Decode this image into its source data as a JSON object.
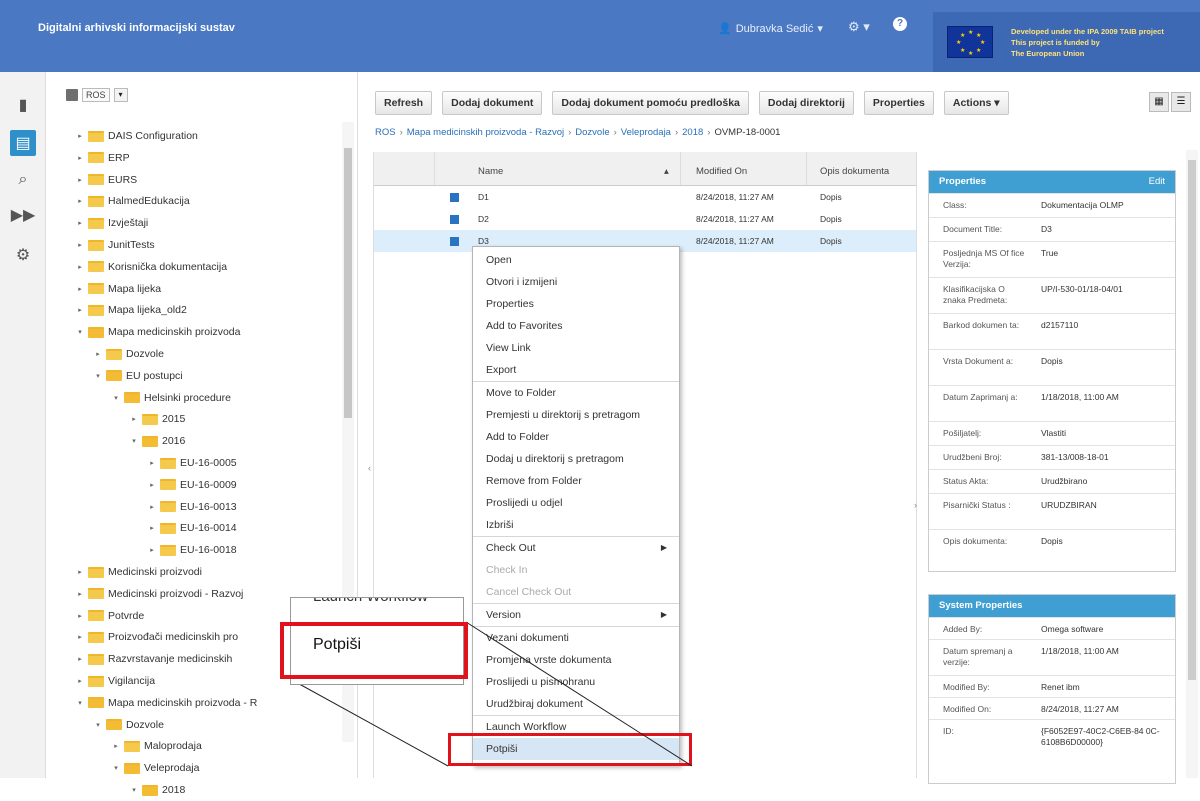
{
  "header": {
    "app_title": "Digitalni arhivski informacijski sustav",
    "user_name": "Dubravka Sedić",
    "user_caret": "▾",
    "eu_text": [
      "Developed under the IPA 2009 TAIB project",
      "This project is funded by",
      "The European Union"
    ]
  },
  "repo": {
    "label": "ROS",
    "arrow": "▾"
  },
  "tree": [
    {
      "label": "DAIS Configuration",
      "depth": 0,
      "open": false
    },
    {
      "label": "ERP",
      "depth": 0,
      "open": false
    },
    {
      "label": "EURS",
      "depth": 0,
      "open": false
    },
    {
      "label": "HalmedEdukacija",
      "depth": 0,
      "open": false
    },
    {
      "label": "Izvještaji",
      "depth": 0,
      "open": false
    },
    {
      "label": "JunitTests",
      "depth": 0,
      "open": false
    },
    {
      "label": "Korisnička dokumentacija",
      "depth": 0,
      "open": false
    },
    {
      "label": "Mapa lijeka",
      "depth": 0,
      "open": false
    },
    {
      "label": "Mapa lijeka_old2",
      "depth": 0,
      "open": false
    },
    {
      "label": "Mapa medicinskih proizvoda",
      "depth": 0,
      "open": true
    },
    {
      "label": "Dozvole",
      "depth": 1,
      "open": false
    },
    {
      "label": "EU postupci",
      "depth": 1,
      "open": true
    },
    {
      "label": "Helsinki procedure",
      "depth": 2,
      "open": true
    },
    {
      "label": "2015",
      "depth": 3,
      "open": false
    },
    {
      "label": "2016",
      "depth": 3,
      "open": true
    },
    {
      "label": "EU-16-0005",
      "depth": 4,
      "open": false
    },
    {
      "label": "EU-16-0009",
      "depth": 4,
      "open": false
    },
    {
      "label": "EU-16-0013",
      "depth": 4,
      "open": false
    },
    {
      "label": "EU-16-0014",
      "depth": 4,
      "open": false
    },
    {
      "label": "EU-16-0018",
      "depth": 4,
      "open": false
    },
    {
      "label": "Medicinski proizvodi",
      "depth": 0,
      "open": false
    },
    {
      "label": "Medicinski proizvodi - Razvoj",
      "depth": 0,
      "open": false
    },
    {
      "label": "Potvrde",
      "depth": 0,
      "open": false
    },
    {
      "label": "Proizvođači medicinskih pro",
      "depth": 0,
      "open": false
    },
    {
      "label": "Razvrstavanje medicinskih",
      "depth": 0,
      "open": false
    },
    {
      "label": "Vigilancija",
      "depth": 0,
      "open": false
    },
    {
      "label": "Mapa medicinskih proizvoda - R",
      "depth": 0,
      "open": true
    },
    {
      "label": "Dozvole",
      "depth": 1,
      "open": true
    },
    {
      "label": "Maloprodaja",
      "depth": 2,
      "open": false
    },
    {
      "label": "Veleprodaja",
      "depth": 2,
      "open": true
    },
    {
      "label": "2018",
      "depth": 3,
      "open": true
    }
  ],
  "toolbar": {
    "buttons": [
      "Refresh",
      "Dodaj dokument",
      "Dodaj dokument pomoću predloška",
      "Dodaj direktorij",
      "Properties",
      "Actions ▾"
    ]
  },
  "breadcrumb": [
    "ROS",
    "Mapa medicinskih proizvoda - Razvoj",
    "Dozvole",
    "Veleprodaja",
    "2018",
    "OVMP-18-0001"
  ],
  "grid": {
    "columns": [
      "Name",
      "Modified On",
      "Opis dokumenta"
    ],
    "sort_indicator": "▴",
    "rows": [
      {
        "name": "D1",
        "modified": "8/24/2018, 11:27 AM",
        "opis": "Dopis"
      },
      {
        "name": "D2",
        "modified": "8/24/2018, 11:27 AM",
        "opis": "Dopis"
      },
      {
        "name": "D3",
        "modified": "8/24/2018, 11:27 AM",
        "opis": "Dopis"
      }
    ]
  },
  "context_menu": {
    "items": [
      {
        "label": "Open",
        "disabled": false
      },
      {
        "label": "Otvori i izmijeni",
        "disabled": false
      },
      {
        "label": "Properties",
        "disabled": false
      },
      {
        "label": "Add to Favorites",
        "disabled": false
      },
      {
        "label": "View Link",
        "disabled": false
      },
      {
        "label": "Export",
        "disabled": false,
        "sep_after": true
      },
      {
        "label": "Move to Folder",
        "disabled": false
      },
      {
        "label": "Premjesti u direktorij s pretragom",
        "disabled": false
      },
      {
        "label": "Add to Folder",
        "disabled": false
      },
      {
        "label": "Dodaj u direktorij s pretragom",
        "disabled": false
      },
      {
        "label": "Remove from Folder",
        "disabled": false
      },
      {
        "label": "Proslijedi u odjel",
        "disabled": false
      },
      {
        "label": "Izbriši",
        "disabled": false,
        "sep_after": true
      },
      {
        "label": "Check Out",
        "disabled": false,
        "submenu": true
      },
      {
        "label": "Check In",
        "disabled": true
      },
      {
        "label": "Cancel Check Out",
        "disabled": true,
        "sep_after": true
      },
      {
        "label": "Version",
        "disabled": false,
        "submenu": true,
        "sep_after": true
      },
      {
        "label": "Vezani dokumenti",
        "disabled": false
      },
      {
        "label": "Promjena vrste dokumenta",
        "disabled": false
      },
      {
        "label": "Proslijedi u pismohranu",
        "disabled": false
      },
      {
        "label": "Urudžbiraj dokument",
        "disabled": false,
        "sep_after": true
      },
      {
        "label": "Launch Workflow",
        "disabled": false
      },
      {
        "label": "Potpiši",
        "disabled": false,
        "highlight": true
      }
    ]
  },
  "zoom_callout": {
    "partial_text": "Launch Workflow",
    "label": "Potpiši"
  },
  "properties_panel": {
    "title": "Properties",
    "edit": "Edit",
    "rows": [
      {
        "k": "Class:",
        "v": "Dokumentacija OLMP"
      },
      {
        "k": "Document Title:",
        "v": "D3"
      },
      {
        "k": "Posljednja MS Of fice Verzija:",
        "v": "True"
      },
      {
        "k": "Klasifikacijska O znaka Predmeta:",
        "v": "UP/I-530-01/18-04/01"
      },
      {
        "k": "Barkod dokumen ta:",
        "v": "d2157110"
      },
      {
        "k": "Vrsta Dokument a:",
        "v": "Dopis"
      },
      {
        "k": "Datum Zaprimanj a:",
        "v": "1/18/2018, 11:00 AM"
      },
      {
        "k": "Pošiljatelj:",
        "v": "Vlastiti"
      },
      {
        "k": "Urudžbeni Broj:",
        "v": "381-13/008-18-01"
      },
      {
        "k": "Status Akta:",
        "v": "Urudžbirano"
      },
      {
        "k": "Pisarnički Status :",
        "v": "URUDZBIRAN"
      },
      {
        "k": "Opis dokumenta:",
        "v": "Dopis"
      }
    ]
  },
  "system_panel": {
    "title": "System Properties",
    "rows": [
      {
        "k": "Added By:",
        "v": "Omega software"
      },
      {
        "k": "Datum spremanj a verzije:",
        "v": "1/18/2018, 11:00 AM"
      },
      {
        "k": "Modified By:",
        "v": "Renet ibm"
      },
      {
        "k": "Modified On:",
        "v": "8/24/2018, 11:27 AM"
      },
      {
        "k": "ID:",
        "v": "{F6052E97-40C2-C6EB-84 0C-6108B6D00000}"
      }
    ]
  },
  "colors": {
    "header": "#4a78c2",
    "accent": "#3f9fd2",
    "highlight_red": "#e0131c"
  }
}
